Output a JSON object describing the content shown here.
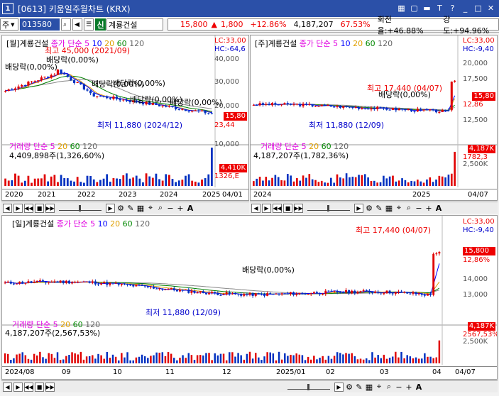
{
  "window": {
    "number": "1",
    "title": "[0613] 키움일주월차트 (KRX)",
    "ctrls": [
      "▦",
      "▢",
      "▬",
      "T",
      "?",
      "_",
      "□",
      "✕"
    ]
  },
  "toolbar": {
    "market": "주",
    "code": "013580",
    "sin": "신",
    "name": "계룡건설",
    "price": "15,800",
    "arrow": "▲",
    "change": "1,800",
    "rate": "+12.86%",
    "volume": "4,187,207",
    "vol_ratio": "67.53%",
    "turnover": "회전율:+46.88%",
    "strength": "강도:+94.96%"
  },
  "monthly": {
    "title": "[월]계룡건설",
    "ma_label": "종가 단순",
    "ma": [
      "5",
      "10",
      "20",
      "60",
      "120"
    ],
    "lc": "LC:33,00",
    "hc": "HC:-64,6",
    "yticks": [
      "40,000",
      "30,000",
      "20,000"
    ],
    "price_tag": "15,80",
    "pct": "23,44",
    "max": "최고 45,000 (2021/09)",
    "min": "최저 11,880 (2024/12)",
    "div": [
      "배당락(0,00%)",
      "배당락(0,00%)",
      "배당락(0,00%)",
      "배당락(0,00%)",
      "배당락(0,00%)",
      "배당락(0,00%)"
    ],
    "vol": {
      "title": "거래량",
      "ma_label": "단순",
      "ma": [
        "5",
        "20",
        "60",
        "120"
      ],
      "value": "4,409,898주(1,326,60%)",
      "tick": "10,000",
      "tag": "4,410K",
      "pct": "1326,E"
    },
    "xticks": [
      "2020",
      "2021",
      "2022",
      "2023",
      "2024",
      "2025"
    ],
    "xend": "04/01"
  },
  "weekly": {
    "title": "[주]계룡건설",
    "ma_label": "종가 단순",
    "ma": [
      "5",
      "10",
      "20",
      "60",
      "120"
    ],
    "lc": "LC:33,00",
    "hc": "HC:-9,40",
    "yticks": [
      "20,000",
      "17,500",
      "12,500"
    ],
    "price_tag": "15,80",
    "pct": "12,86",
    "max": "최고 17,440 (04/07)",
    "min": "최저 11,880 (12/09)",
    "div": "배당락(0,00%)",
    "vol": {
      "title": "거래량",
      "ma_label": "단순",
      "ma": [
        "5",
        "20",
        "60",
        "120"
      ],
      "value": "4,187,207주(1,782,36%)",
      "tick": "2,500K",
      "tag": "4,187K",
      "pct": "1782,3"
    },
    "xticks": [
      "2024",
      "2025"
    ],
    "xend": "04/07"
  },
  "daily": {
    "title": "[일]계룡건설",
    "ma_label": "종가 단순",
    "ma": [
      "5",
      "10",
      "20",
      "60",
      "120"
    ],
    "lc": "LC:33,00",
    "hc": "HC:-9,40",
    "yticks": [
      "14,000",
      "13,000"
    ],
    "price_tag": "15,800",
    "pct": "12,86%",
    "max": "최고 17,440 (04/07)",
    "min": "최저 11,880 (12/09)",
    "div": "배당락(0,00%)",
    "vol": {
      "title": "거래량",
      "ma_label": "단순",
      "ma": [
        "5",
        "20",
        "60",
        "120"
      ],
      "value": "4,187,207주(2,567,53%)",
      "tick": "2,500K",
      "tag": "4,187K",
      "pct": "2567,53%"
    },
    "xticks": [
      "2024/08",
      "09",
      "10",
      "11",
      "12",
      "2025/01",
      "02",
      "03",
      "04"
    ],
    "xend": "04/07"
  },
  "colors": {
    "ma5": "#e000e0",
    "ma10": "#0000ff",
    "ma20": "#e0a000",
    "ma60": "#008000",
    "ma120": "#888888",
    "up": "#e00000",
    "down": "#0030c0"
  }
}
